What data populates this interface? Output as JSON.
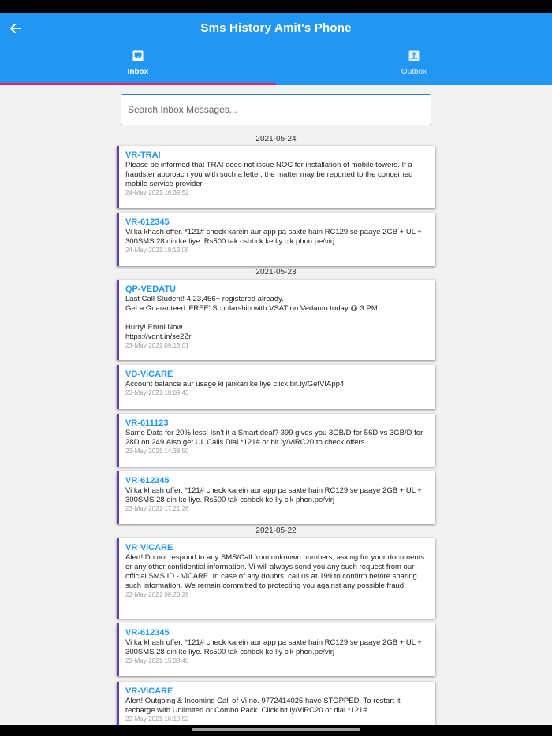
{
  "app_bar": {
    "title": "Sms History Amit's Phone",
    "back_icon": "arrow-left-icon"
  },
  "tabs": [
    {
      "label": "Inbox",
      "icon": "inbox-icon",
      "active": true
    },
    {
      "label": "Outbox",
      "icon": "outbox-icon",
      "active": false
    }
  ],
  "colors": {
    "primary": "#2196f3",
    "indicator": "#e91e63",
    "card_accent": "#673ab7"
  },
  "search": {
    "placeholder": "Search Inbox Messages...",
    "value": ""
  },
  "groups": [
    {
      "date": "2021-05-24",
      "messages": [
        {
          "sender": "VR-TRAI",
          "body": "Please be informed that TRAI does not issue NOC for installation of mobile towers. If a fraudster approach you with such a letter, the matter may be reported to the concerned mobile service provider.",
          "time": "24-May-2021 16:39:52"
        },
        {
          "sender": "VR-612345",
          "body": "Vi ka khash offer. *121# check karein aur app pa sakte hain RC129 se paaye 2GB + UL + 300SMS  28 din ke liye. Rs500 tak cshbck ke liy clk phon.pe/virj",
          "time": "24-May-2021 19:13:06"
        }
      ]
    },
    {
      "date": "2021-05-23",
      "messages": [
        {
          "sender": "QP-VEDATU",
          "body": "Last Call Student! 4,23,456+ registered already.\nGet a Guaranteed 'FREE' Scholarship with VSAT on Vedantu today @ 3 PM\n\nHurry! Enrol Now\nhttps://vdnt.in/se2Zr",
          "time": "23-May-2021 09:13:01"
        },
        {
          "sender": "VD-ViCARE",
          "body": "Account balance aur usage ki jankari ke liye click bit.ly/GetVIApp4",
          "time": "23-May-2021 10:09:43"
        },
        {
          "sender": "VR-611123",
          "body": "Same Data for 20% less! Isn't it a Smart deal? 399 gives you 3GB/D for 56D vs 3GB/D for 28D on 249.Also get UL Calls.Dial *121# or bit.ly/ViRC20 to check offers",
          "time": "23-May-2021 14:38:50"
        },
        {
          "sender": "VR-612345",
          "body": "Vi ka khash offer. *121# check karein aur app pa sakte hain RC129 se paaye 2GB + UL + 300SMS  28 din ke liye. Rs500 tak cshbck ke liy clk phon.pe/virj",
          "time": "23-May-2021 17:21:26"
        }
      ]
    },
    {
      "date": "2021-05-22",
      "messages": [
        {
          "sender": "VR-ViCARE",
          "body": "Alert! Do not respond to any SMS/Call from unknown numbers, asking for your documents or any other confidential information. Vi will always send you any such request from our official SMS ID - ViCARE. In case of any doubts, call us at 199 to confirm before sharing such information. We remain committed to protecting you against any possible fraud.",
          "time": "22-May-2021 08:20:28"
        },
        {
          "sender": "VR-612345",
          "body": "Vi ka khash offer. *121# check karein aur app pa sakte hain RC129 se paaye 2GB + UL + 300SMS  28 din ke liye. Rs500 tak cshbck ke liy clk phon.pe/virj",
          "time": "22-May-2021 15:38:40"
        },
        {
          "sender": "VR-ViCARE",
          "body": "Alert! Outgoing & Incoming Call of Vi no. 9772414025 have STOPPED. To restart it recharge with Unlimited or Combo Pack. Click bit.ly/ViRC20 or dial *121#",
          "time": "22-May-2021 16:19:52"
        }
      ]
    }
  ]
}
